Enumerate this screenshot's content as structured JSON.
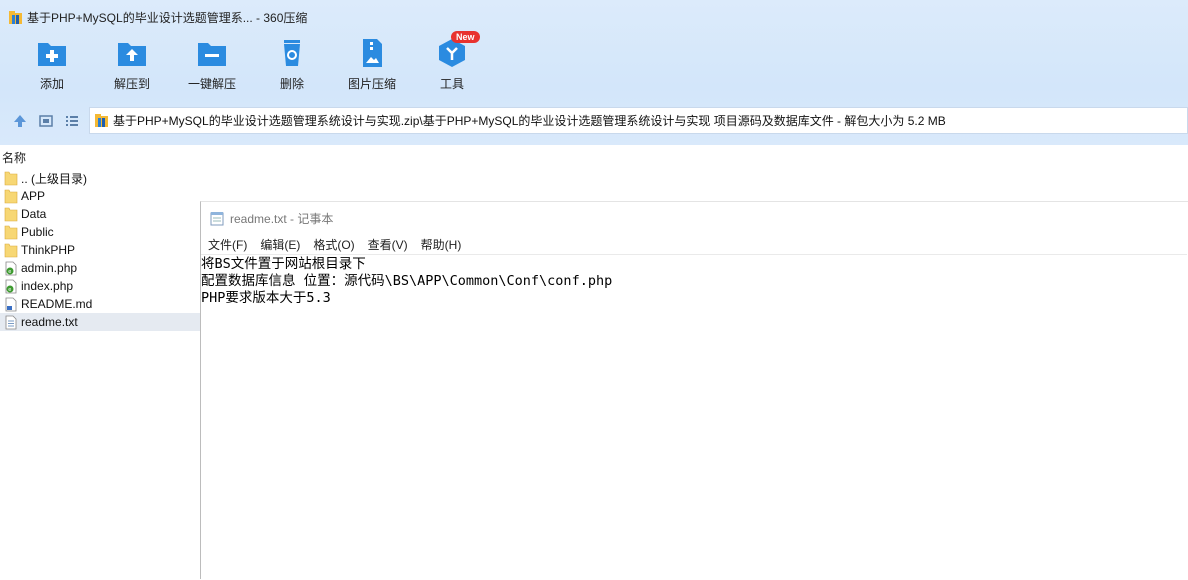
{
  "window": {
    "title": "基于PHP+MySQL的毕业设计选题管理系... - 360压缩"
  },
  "toolbar": {
    "items": [
      {
        "label": "添加",
        "icon": "add-icon"
      },
      {
        "label": "解压到",
        "icon": "extract-to-icon"
      },
      {
        "label": "一键解压",
        "icon": "one-click-extract-icon"
      },
      {
        "label": "删除",
        "icon": "delete-icon"
      },
      {
        "label": "图片压缩",
        "icon": "image-compress-icon"
      },
      {
        "label": "工具",
        "icon": "tools-icon"
      }
    ],
    "new_badge": "New"
  },
  "path": {
    "text": "基于PHP+MySQL的毕业设计选题管理系统设计与实现.zip\\基于PHP+MySQL的毕业设计选题管理系统设计与实现 项目源码及数据库文件 - 解包大小为 5.2 MB"
  },
  "list": {
    "header": "名称",
    "files": [
      {
        "name": ".. (上级目录)",
        "type": "folder"
      },
      {
        "name": "APP",
        "type": "folder"
      },
      {
        "name": "Data",
        "type": "folder"
      },
      {
        "name": "Public",
        "type": "folder"
      },
      {
        "name": "ThinkPHP",
        "type": "folder"
      },
      {
        "name": "admin.php",
        "type": "php"
      },
      {
        "name": "index.php",
        "type": "php"
      },
      {
        "name": "README.md",
        "type": "md"
      },
      {
        "name": "readme.txt",
        "type": "txt",
        "selected": true
      }
    ]
  },
  "notepad": {
    "title": "readme.txt - 记事本",
    "menu": [
      "文件(F)",
      "编辑(E)",
      "格式(O)",
      "查看(V)",
      "帮助(H)"
    ],
    "lines": [
      "将BS文件置于网站根目录下",
      "配置数据库信息 位置：源代码\\BS\\APP\\Common\\Conf\\conf.php",
      "PHP要求版本大于5.3"
    ]
  },
  "colors": {
    "accent": "#2b8be0",
    "badge": "#e8322f",
    "toolbar_bg": "#d6e8fb",
    "selected_row": "#e5eaf1"
  }
}
